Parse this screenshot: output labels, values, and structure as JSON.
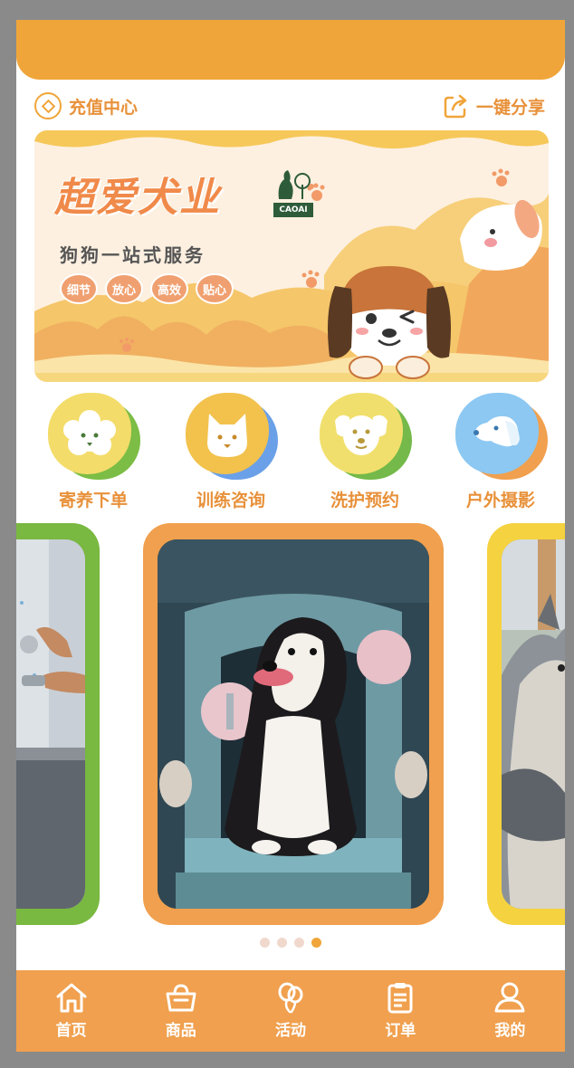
{
  "actions": {
    "recharge_label": "充值中心",
    "share_label": "一键分享"
  },
  "banner": {
    "title": "超爱犬业",
    "brand": "CAOAI",
    "subtitle": "狗狗一站式服务",
    "tags": [
      "细节",
      "放心",
      "高效",
      "贴心"
    ]
  },
  "services": [
    {
      "label": "寄养下单",
      "icon": "poodle-face-icon",
      "color": "#f3dc6a",
      "back": "#7cbd45"
    },
    {
      "label": "训练咨询",
      "icon": "shiba-face-icon",
      "color": "#f2c24d",
      "back": "#6aa0e8"
    },
    {
      "label": "洗护预约",
      "icon": "labrador-face-icon",
      "color": "#f1df6d",
      "back": "#74b94a"
    },
    {
      "label": "户外摄影",
      "icon": "dog-profile-icon",
      "color": "#8cc8f2",
      "back": "#f0a04e"
    }
  ],
  "carousel": {
    "cards": [
      {
        "name": "dog-bathing-photo",
        "frame": "#79b841"
      },
      {
        "name": "border-collie-photo",
        "frame": "#f0a04e"
      },
      {
        "name": "fluffy-dog-photo",
        "frame": "#f5d23f"
      }
    ],
    "active_index": 3,
    "count": 4
  },
  "tabbar": {
    "items": [
      {
        "label": "首页",
        "icon": "home-icon"
      },
      {
        "label": "商品",
        "icon": "shopping-basket-icon"
      },
      {
        "label": "活动",
        "icon": "balloons-icon"
      },
      {
        "label": "订单",
        "icon": "clipboard-icon"
      },
      {
        "label": "我的",
        "icon": "user-icon"
      }
    ]
  },
  "colors": {
    "accent": "#f0a53a",
    "text_accent": "#e8913a"
  }
}
